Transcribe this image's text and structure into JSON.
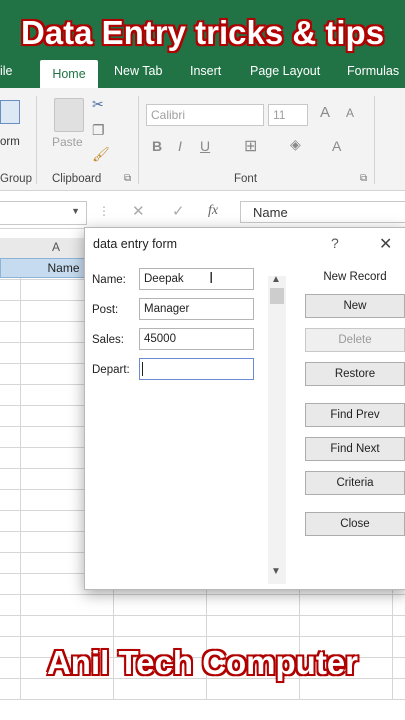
{
  "overlay": {
    "top_caption": "Data Entry tricks & tips",
    "bottom_caption": "Anil Tech Computer"
  },
  "menu": {
    "file": "ile",
    "home": "Home",
    "new_tab": "New Tab",
    "insert": "Insert",
    "page_layout": "Page Layout",
    "formulas": "Formulas"
  },
  "ribbon": {
    "font_name": "Calibri",
    "font_size": "11",
    "paste_label": "Paste",
    "form_label": "orm",
    "groups": {
      "group": "Group",
      "clipboard": "Clipboard",
      "font": "Font"
    }
  },
  "formula_bar": {
    "fx": "fx",
    "content": "Name"
  },
  "sheet": {
    "column_a": "A",
    "cell_a1": "Name"
  },
  "dialog": {
    "title": "data entry form",
    "help": "?",
    "close": "✕",
    "record_status": "New Record",
    "fields": [
      {
        "label": "Name:",
        "value": "Deepak"
      },
      {
        "label": "Post:",
        "value": "Manager"
      },
      {
        "label": "Sales:",
        "value": "45000"
      },
      {
        "label": "Depart:",
        "value": ""
      }
    ],
    "buttons": {
      "new": "New",
      "delete": "Delete",
      "restore": "Restore",
      "find_prev": "Find Prev",
      "find_next": "Find Next",
      "criteria": "Criteria",
      "close": "Close"
    }
  },
  "colors": {
    "excel_green": "#217346",
    "caption_red": "#d32020"
  }
}
